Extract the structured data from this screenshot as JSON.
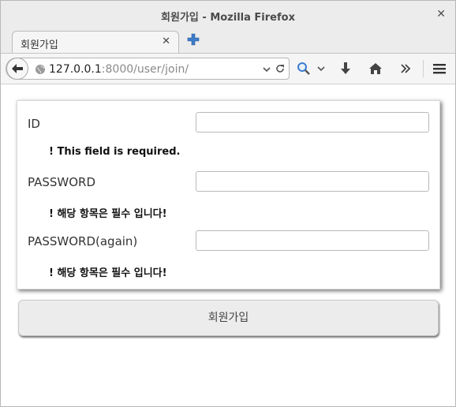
{
  "window": {
    "title": "회원가입 - Mozilla Firefox"
  },
  "tab": {
    "label": "회원가입"
  },
  "address": {
    "host": "127.0.0.1",
    "rest": ":8000/user/join/"
  },
  "form": {
    "fields": [
      {
        "label": "ID",
        "value": "",
        "error": "! This field is required."
      },
      {
        "label": "PASSWORD",
        "value": "",
        "error": "! 해당 항목은 필수 입니다!"
      },
      {
        "label": "PASSWORD(again)",
        "value": "",
        "error": "! 해당 항목은 필수 입니다!"
      }
    ],
    "submit_label": "회원가입"
  }
}
